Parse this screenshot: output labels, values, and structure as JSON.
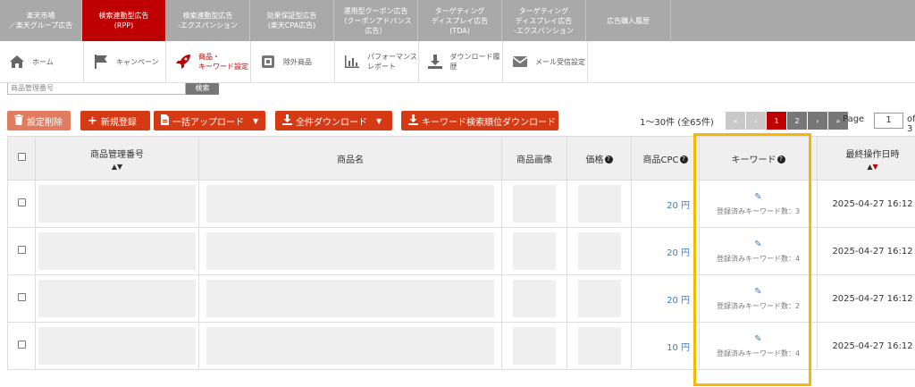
{
  "top_nav": [
    {
      "line1": "楽天市場",
      "line2": "／楽天グループ広告",
      "line3": ""
    },
    {
      "line1": "検索連動型広告",
      "line2": "(RPP)",
      "line3": ""
    },
    {
      "line1": "検索連動型広告",
      "line2": "-エクスパンション",
      "line3": ""
    },
    {
      "line1": "効果保証型広告",
      "line2": "(楽天CPA広告)",
      "line3": ""
    },
    {
      "line1": "運用型クーポン広告",
      "line2": "（クーポンアドバンス",
      "line3": "広告）"
    },
    {
      "line1": "ターゲティング",
      "line2": "ディスプレイ広告",
      "line3": "(TDA)"
    },
    {
      "line1": "ターゲティング",
      "line2": "ディスプレイ広告",
      "line3": "-エクスパンション"
    },
    {
      "line1": "広告購入履歴",
      "line2": "",
      "line3": ""
    }
  ],
  "sub_nav": [
    {
      "label1": "ホーム",
      "label2": "",
      "icon": "home-icon"
    },
    {
      "label1": "キャンペーン",
      "label2": "",
      "icon": "flag-icon"
    },
    {
      "label1": "商品・",
      "label2": "キーワード設定",
      "icon": "rocket-icon"
    },
    {
      "label1": "除外商品",
      "label2": "",
      "icon": "box-icon"
    },
    {
      "label1": "パフォーマンス",
      "label2": "レポート",
      "icon": "bar-chart-icon"
    },
    {
      "label1": "ダウンロード履歴",
      "label2": "",
      "icon": "download-icon"
    },
    {
      "label1": "メール受信設定",
      "label2": "",
      "icon": "mail-icon"
    }
  ],
  "search": {
    "placeholder": "商品管理番号",
    "button": "検索"
  },
  "toolbar": {
    "delete": "設定削除",
    "new": "新規登録",
    "bulk_upload": "一括アップロード",
    "all_download": "全件ダウンロード",
    "keyword_rank_download": "キーワード検索順位ダウンロード"
  },
  "pagination": {
    "info": "1〜30件 (全65件)",
    "pages": [
      "«",
      "‹",
      "1",
      "2",
      "›",
      "»"
    ],
    "page_label": "Page",
    "page_value": "1",
    "of_label": "of 3"
  },
  "table": {
    "headers": {
      "product_id": "商品管理番号",
      "product_name": "商品名",
      "image": "商品画像",
      "price": "価格",
      "cpc": "商品CPC",
      "keyword": "キーワード",
      "last_updated": "最終操作日時"
    },
    "rows": [
      {
        "cpc": "20 円",
        "keyword_edit": "✎",
        "keyword_count": "登録済みキーワード数：3",
        "date": "2025-04-27 16:12"
      },
      {
        "cpc": "20 円",
        "keyword_edit": "✎",
        "keyword_count": "登録済みキーワード数：4",
        "date": "2025-04-27 16:12"
      },
      {
        "cpc": "20 円",
        "keyword_edit": "✎",
        "keyword_count": "登録済みキーワード数：2",
        "date": "2025-04-27 16:12"
      },
      {
        "cpc": "10 円",
        "keyword_edit": "✎",
        "keyword_count": "登録済みキーワード数：4",
        "date": "2025-04-27 16:12"
      }
    ]
  },
  "colors": {
    "brand_red": "#bf0000",
    "button_red": "#d53a14",
    "link_blue": "#3a7bbf",
    "highlight": "#f5b800"
  }
}
